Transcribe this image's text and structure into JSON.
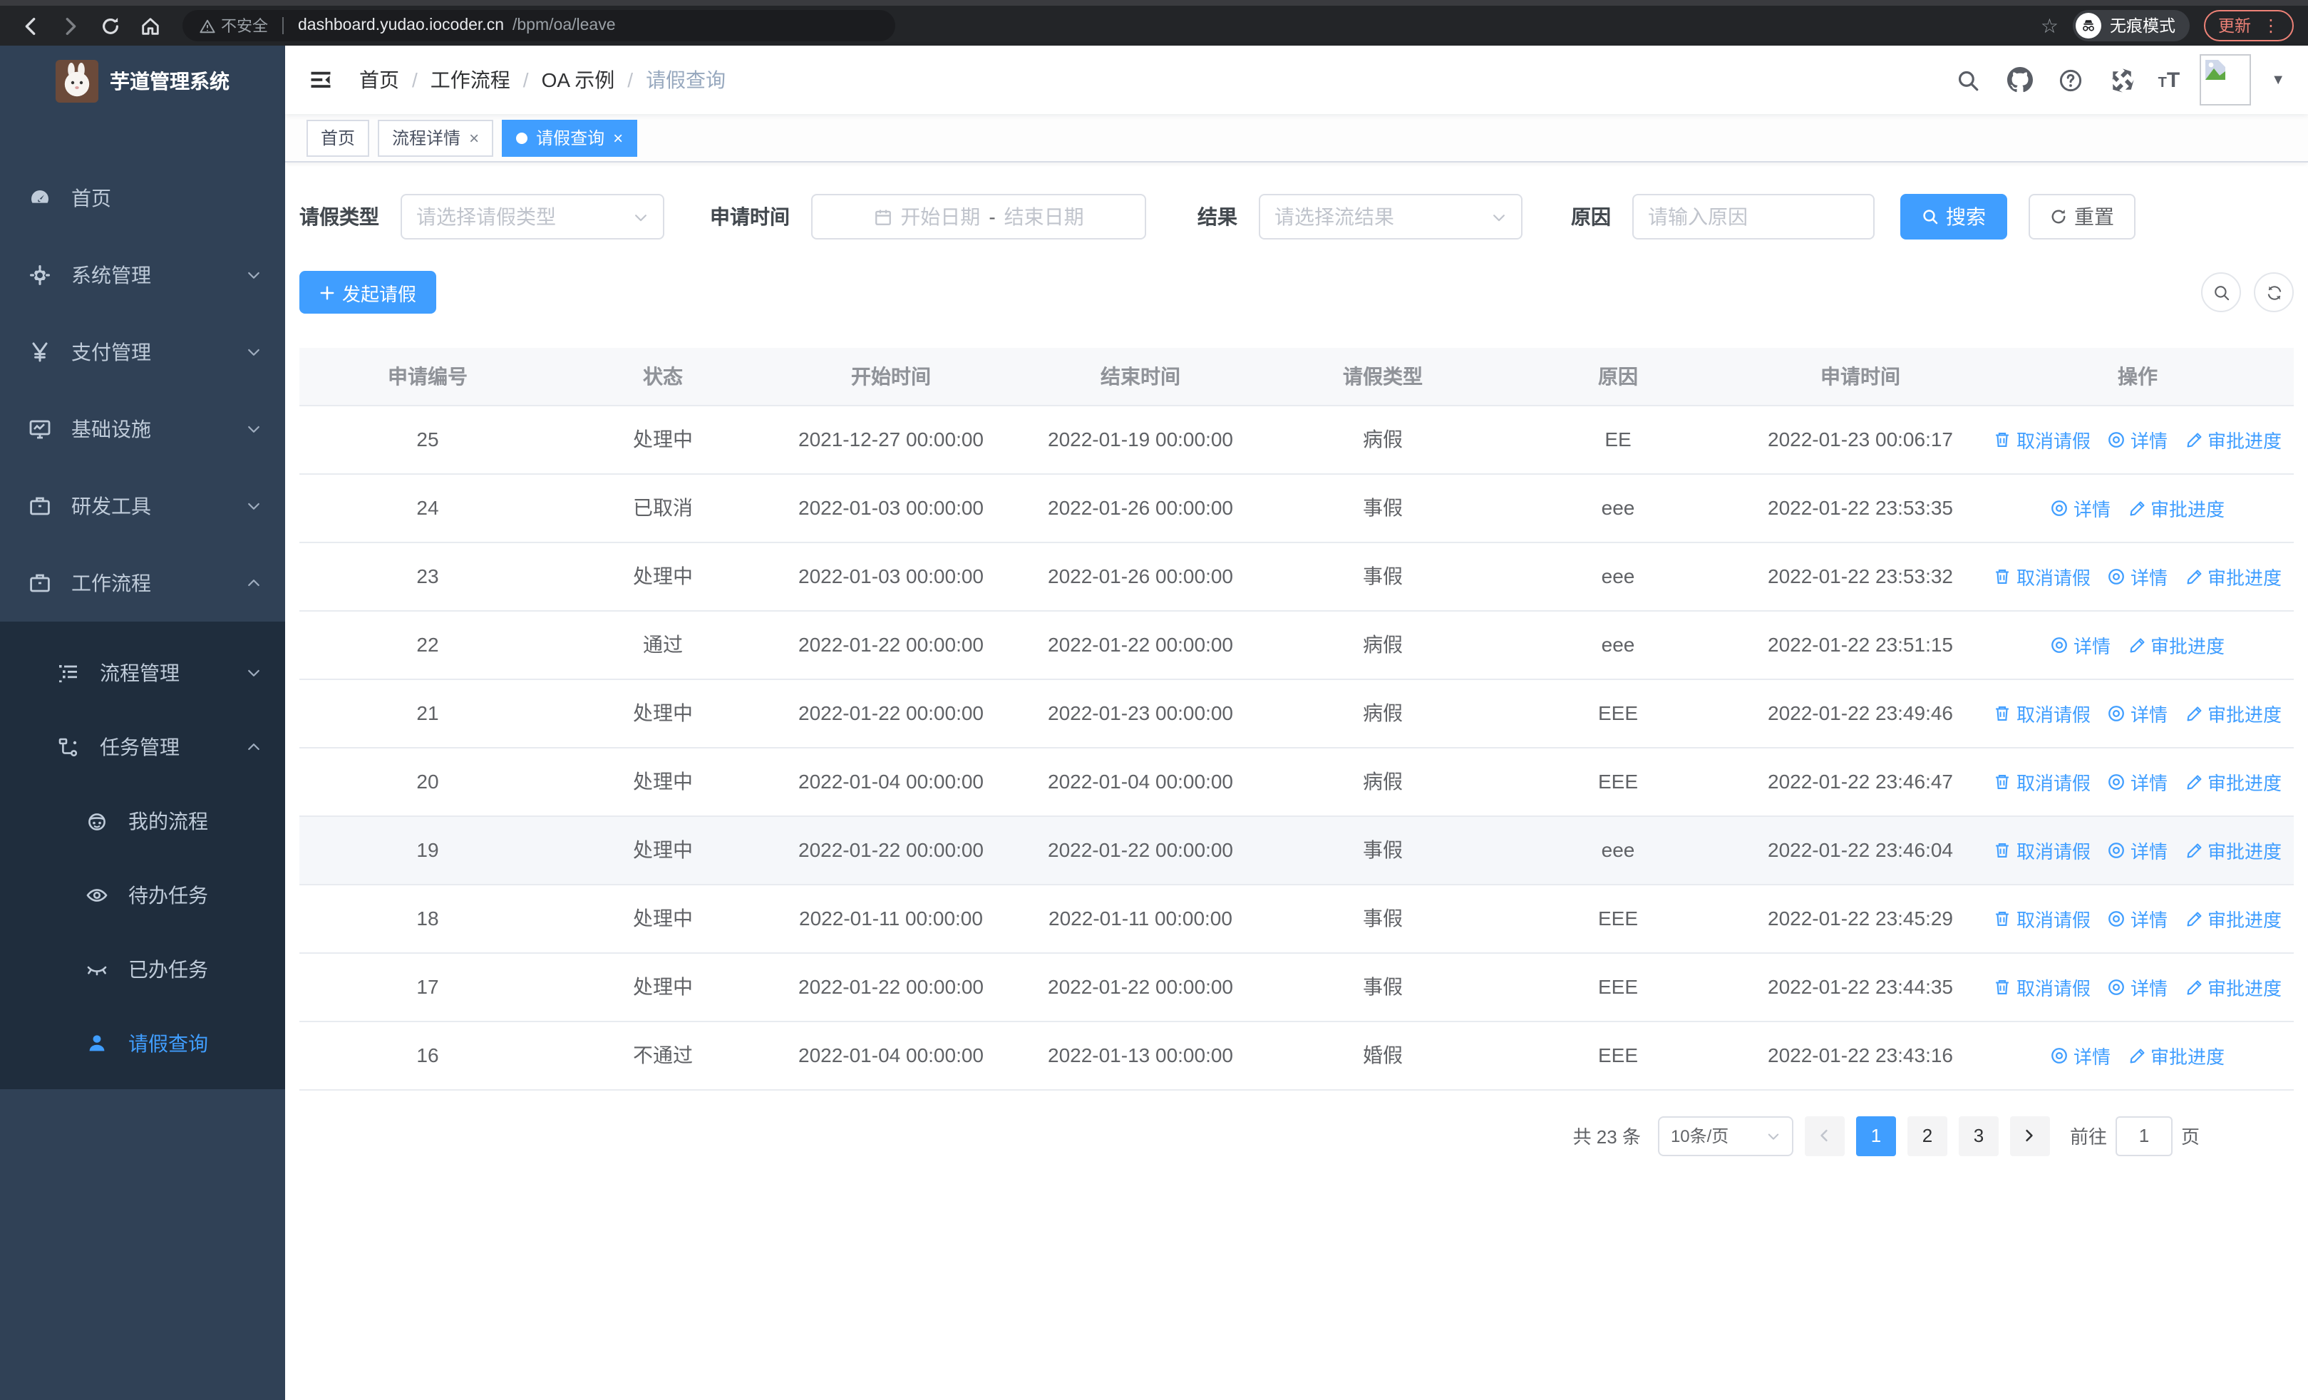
{
  "browser": {
    "security_label": "不安全",
    "url_host": "dashboard.yudao.iocoder.cn",
    "url_path": "/bpm/oa/leave",
    "incognito_label": "无痕模式",
    "update_label": "更新"
  },
  "sidebar": {
    "title": "芋道管理系统",
    "menu": [
      {
        "key": "home",
        "label": "首页",
        "icon": "gauge-icon",
        "level": 1,
        "chevron": "",
        "submenu": false,
        "active": false
      },
      {
        "key": "system",
        "label": "系统管理",
        "icon": "gear-icon",
        "level": 1,
        "chevron": "down",
        "submenu": false,
        "active": false
      },
      {
        "key": "pay",
        "label": "支付管理",
        "icon": "yen-icon",
        "level": 1,
        "chevron": "down",
        "submenu": false,
        "active": false
      },
      {
        "key": "infra",
        "label": "基础设施",
        "icon": "monitor-icon",
        "level": 1,
        "chevron": "down",
        "submenu": false,
        "active": false
      },
      {
        "key": "devtools",
        "label": "研发工具",
        "icon": "briefcase-icon",
        "level": 1,
        "chevron": "down",
        "submenu": false,
        "active": false
      },
      {
        "key": "workflow",
        "label": "工作流程",
        "icon": "briefcase-icon",
        "level": 1,
        "chevron": "up",
        "submenu": false,
        "active": false
      },
      {
        "key": "process-mgmt",
        "label": "流程管理",
        "icon": "list-tree-icon",
        "level": 2,
        "chevron": "down",
        "submenu": true,
        "active": false
      },
      {
        "key": "task-mgmt",
        "label": "任务管理",
        "icon": "flow-icon",
        "level": 2,
        "chevron": "up",
        "submenu": true,
        "active": false
      },
      {
        "key": "my-process",
        "label": "我的流程",
        "icon": "face-icon",
        "level": 3,
        "chevron": "",
        "submenu": true,
        "active": false
      },
      {
        "key": "todo-task",
        "label": "待办任务",
        "icon": "eye-icon",
        "level": 3,
        "chevron": "",
        "submenu": true,
        "active": false
      },
      {
        "key": "done-task",
        "label": "已办任务",
        "icon": "eye-closed-icon",
        "level": 3,
        "chevron": "",
        "submenu": true,
        "active": false
      },
      {
        "key": "leave-query",
        "label": "请假查询",
        "icon": "user-icon",
        "level": 3,
        "chevron": "",
        "submenu": true,
        "active": true
      }
    ]
  },
  "breadcrumb": [
    "首页",
    "工作流程",
    "OA 示例",
    "请假查询"
  ],
  "tags": [
    {
      "label": "首页",
      "closable": false,
      "active": false
    },
    {
      "label": "流程详情",
      "closable": true,
      "active": false
    },
    {
      "label": "请假查询",
      "closable": true,
      "active": true
    }
  ],
  "filters": {
    "leave_type": {
      "label": "请假类型",
      "placeholder": "请选择请假类型"
    },
    "apply_time": {
      "label": "申请时间",
      "start_placeholder": "开始日期",
      "separator": "-",
      "end_placeholder": "结束日期"
    },
    "result": {
      "label": "结果",
      "placeholder": "请选择流结果"
    },
    "reason": {
      "label": "原因",
      "placeholder": "请输入原因"
    },
    "search_label": "搜索",
    "reset_label": "重置"
  },
  "toolbar": {
    "create_label": "发起请假"
  },
  "table": {
    "columns": [
      "申请编号",
      "状态",
      "开始时间",
      "结束时间",
      "请假类型",
      "原因",
      "申请时间",
      "操作"
    ],
    "action_labels": {
      "cancel": "取消请假",
      "detail": "详情",
      "progress": "审批进度"
    },
    "action_icons": {
      "cancel": "trash-icon",
      "detail": "view-icon",
      "progress": "edit-icon"
    },
    "rows": [
      {
        "id": "25",
        "status": "处理中",
        "start": "2021-12-27 00:00:00",
        "end": "2022-01-19 00:00:00",
        "type": "病假",
        "reason": "EE",
        "apply_time": "2022-01-23 00:06:17",
        "actions": [
          "cancel",
          "detail",
          "progress"
        ],
        "highlighted": false
      },
      {
        "id": "24",
        "status": "已取消",
        "start": "2022-01-03 00:00:00",
        "end": "2022-01-26 00:00:00",
        "type": "事假",
        "reason": "eee",
        "apply_time": "2022-01-22 23:53:35",
        "actions": [
          "detail",
          "progress"
        ],
        "highlighted": false
      },
      {
        "id": "23",
        "status": "处理中",
        "start": "2022-01-03 00:00:00",
        "end": "2022-01-26 00:00:00",
        "type": "事假",
        "reason": "eee",
        "apply_time": "2022-01-22 23:53:32",
        "actions": [
          "cancel",
          "detail",
          "progress"
        ],
        "highlighted": false
      },
      {
        "id": "22",
        "status": "通过",
        "start": "2022-01-22 00:00:00",
        "end": "2022-01-22 00:00:00",
        "type": "病假",
        "reason": "eee",
        "apply_time": "2022-01-22 23:51:15",
        "actions": [
          "detail",
          "progress"
        ],
        "highlighted": false
      },
      {
        "id": "21",
        "status": "处理中",
        "start": "2022-01-22 00:00:00",
        "end": "2022-01-23 00:00:00",
        "type": "病假",
        "reason": "EEE",
        "apply_time": "2022-01-22 23:49:46",
        "actions": [
          "cancel",
          "detail",
          "progress"
        ],
        "highlighted": false
      },
      {
        "id": "20",
        "status": "处理中",
        "start": "2022-01-04 00:00:00",
        "end": "2022-01-04 00:00:00",
        "type": "病假",
        "reason": "EEE",
        "apply_time": "2022-01-22 23:46:47",
        "actions": [
          "cancel",
          "detail",
          "progress"
        ],
        "highlighted": false
      },
      {
        "id": "19",
        "status": "处理中",
        "start": "2022-01-22 00:00:00",
        "end": "2022-01-22 00:00:00",
        "type": "事假",
        "reason": "eee",
        "apply_time": "2022-01-22 23:46:04",
        "actions": [
          "cancel",
          "detail",
          "progress"
        ],
        "highlighted": true
      },
      {
        "id": "18",
        "status": "处理中",
        "start": "2022-01-11 00:00:00",
        "end": "2022-01-11 00:00:00",
        "type": "事假",
        "reason": "EEE",
        "apply_time": "2022-01-22 23:45:29",
        "actions": [
          "cancel",
          "detail",
          "progress"
        ],
        "highlighted": false
      },
      {
        "id": "17",
        "status": "处理中",
        "start": "2022-01-22 00:00:00",
        "end": "2022-01-22 00:00:00",
        "type": "事假",
        "reason": "EEE",
        "apply_time": "2022-01-22 23:44:35",
        "actions": [
          "cancel",
          "detail",
          "progress"
        ],
        "highlighted": false
      },
      {
        "id": "16",
        "status": "不通过",
        "start": "2022-01-04 00:00:00",
        "end": "2022-01-13 00:00:00",
        "type": "婚假",
        "reason": "EEE",
        "apply_time": "2022-01-22 23:43:16",
        "actions": [
          "detail",
          "progress"
        ],
        "highlighted": false
      }
    ]
  },
  "pagination": {
    "total_label": "共 23 条",
    "page_size_label": "10条/页",
    "pages": [
      "1",
      "2",
      "3"
    ],
    "active_page": "1",
    "goto_label": "前往",
    "goto_value": "1",
    "goto_unit": "页"
  },
  "colors": {
    "primary": "#409EFF",
    "sidebar_bg": "#304156",
    "submenu_bg": "#1f2d3d",
    "update_accent": "#ee8277"
  }
}
